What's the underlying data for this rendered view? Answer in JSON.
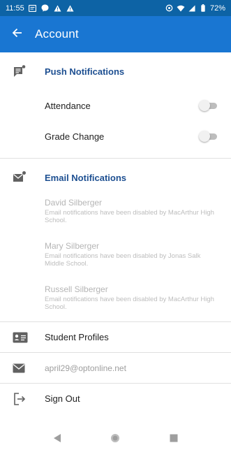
{
  "status_bar": {
    "time": "11:55",
    "battery": "72%",
    "icons_left": [
      "notification-icon",
      "messenger-icon",
      "alert-icon",
      "alert-icon"
    ],
    "icons_right": [
      "vpn-key-icon",
      "wifi-icon",
      "signal-icon",
      "battery-icon"
    ]
  },
  "app_bar": {
    "title": "Account",
    "back_icon": "arrow-left-icon",
    "color": "#1976d2",
    "status_color": "#0d63a5"
  },
  "push_notifications": {
    "title": "Push Notifications",
    "icon": "message-alert-icon",
    "items": [
      {
        "label": "Attendance",
        "enabled": false
      },
      {
        "label": "Grade Change",
        "enabled": false
      }
    ]
  },
  "email_notifications": {
    "title": "Email Notifications",
    "icon": "email-alert-icon",
    "entries": [
      {
        "name": "David Silberger",
        "message": "Email notifications have been disabled by MacArthur High School."
      },
      {
        "name": "Mary Silberger",
        "message": "Email notifications have been disabled by Jonas Salk Middle School."
      },
      {
        "name": "Russell Silberger",
        "message": "Email notifications have been disabled by MacArthur High School."
      }
    ]
  },
  "menu": {
    "student_profiles": {
      "label": "Student Profiles",
      "icon": "id-card-icon"
    },
    "email": {
      "label": "april29@optonline.net",
      "icon": "email-icon"
    },
    "sign_out": {
      "label": "Sign Out",
      "icon": "logout-icon"
    }
  },
  "colors": {
    "section_title": "#1d4f91",
    "muted_text": "#b5b5b5"
  }
}
